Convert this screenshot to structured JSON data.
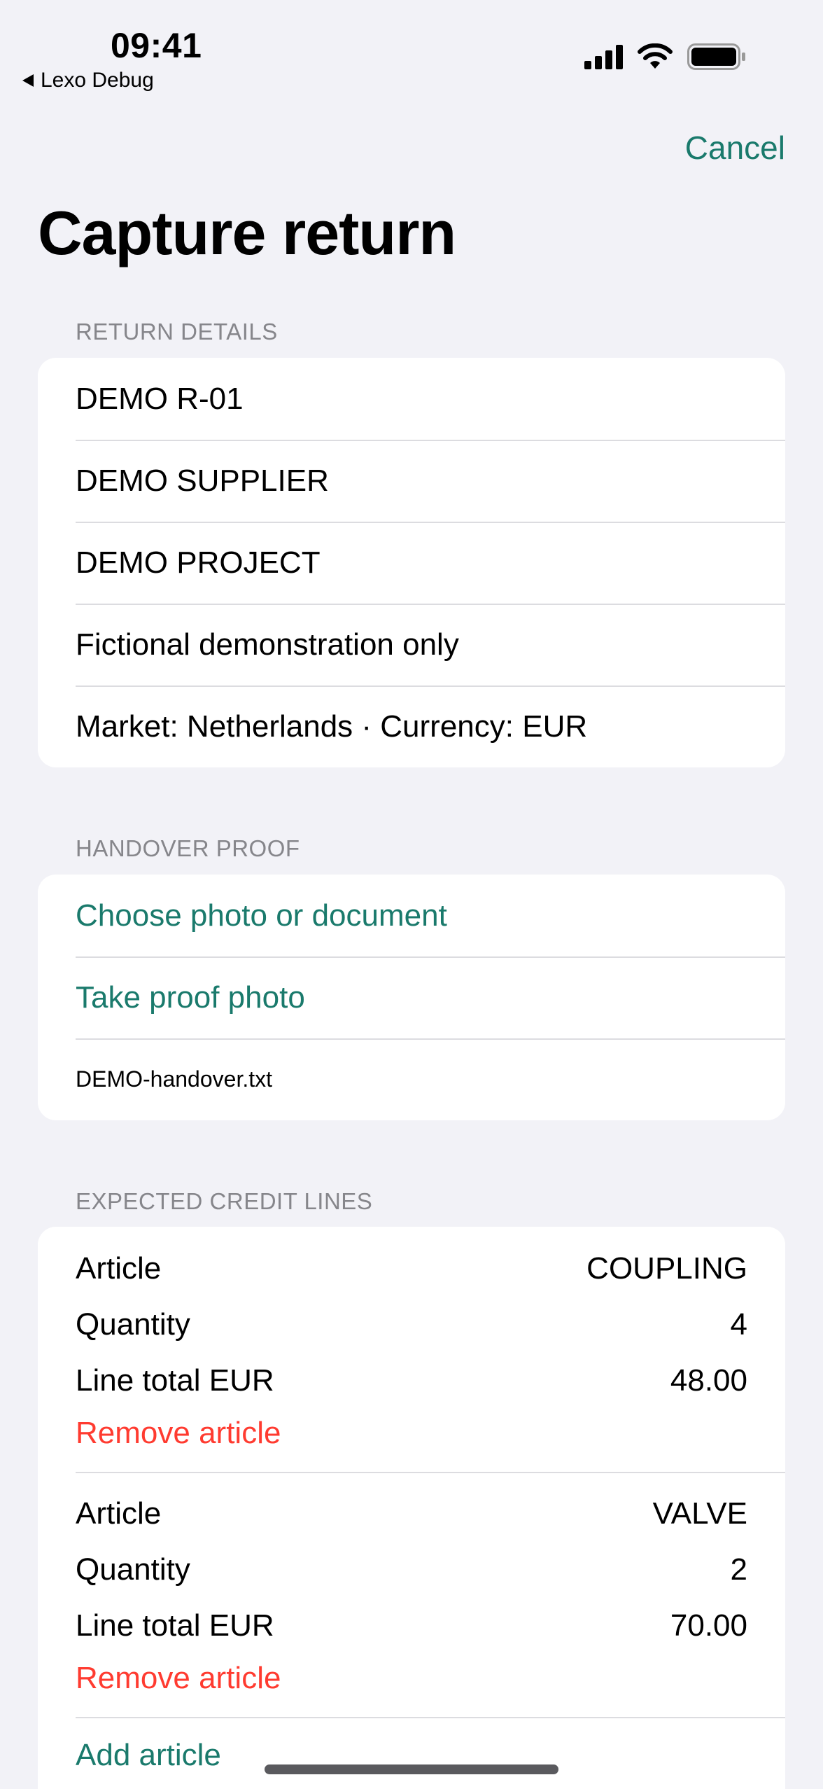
{
  "status_bar": {
    "time": "09:41",
    "back_app": "Lexo Debug",
    "icons": [
      "cellular-signal-icon",
      "wifi-icon",
      "battery-icon"
    ]
  },
  "nav": {
    "cancel_label": "Cancel",
    "title": "Capture return"
  },
  "return_details": {
    "header": "RETURN DETAILS",
    "rows": [
      "DEMO R-01",
      "DEMO SUPPLIER",
      "DEMO PROJECT",
      "Fictional demonstration only",
      "Market: Netherlands · Currency: EUR"
    ]
  },
  "handover_proof": {
    "header": "HANDOVER PROOF",
    "choose_label": "Choose photo or document",
    "take_label": "Take proof photo",
    "file_name": "DEMO-handover.txt"
  },
  "credit_lines": {
    "header": "EXPECTED CREDIT LINES",
    "items": [
      {
        "article_label": "Article",
        "article_value": "COUPLING",
        "quantity_label": "Quantity",
        "quantity_value": "4",
        "total_label": "Line total EUR",
        "total_value": "48.00",
        "remove_label": "Remove article"
      },
      {
        "article_label": "Article",
        "article_value": "VALVE",
        "quantity_label": "Quantity",
        "quantity_value": "2",
        "total_label": "Line total EUR",
        "total_value": "70.00",
        "remove_label": "Remove article"
      }
    ],
    "add_label": "Add article"
  },
  "colors": {
    "accent": "#1a7a6c",
    "destructive": "#ff3b30",
    "background": "#f2f2f7",
    "secondary_text": "#86868b"
  }
}
